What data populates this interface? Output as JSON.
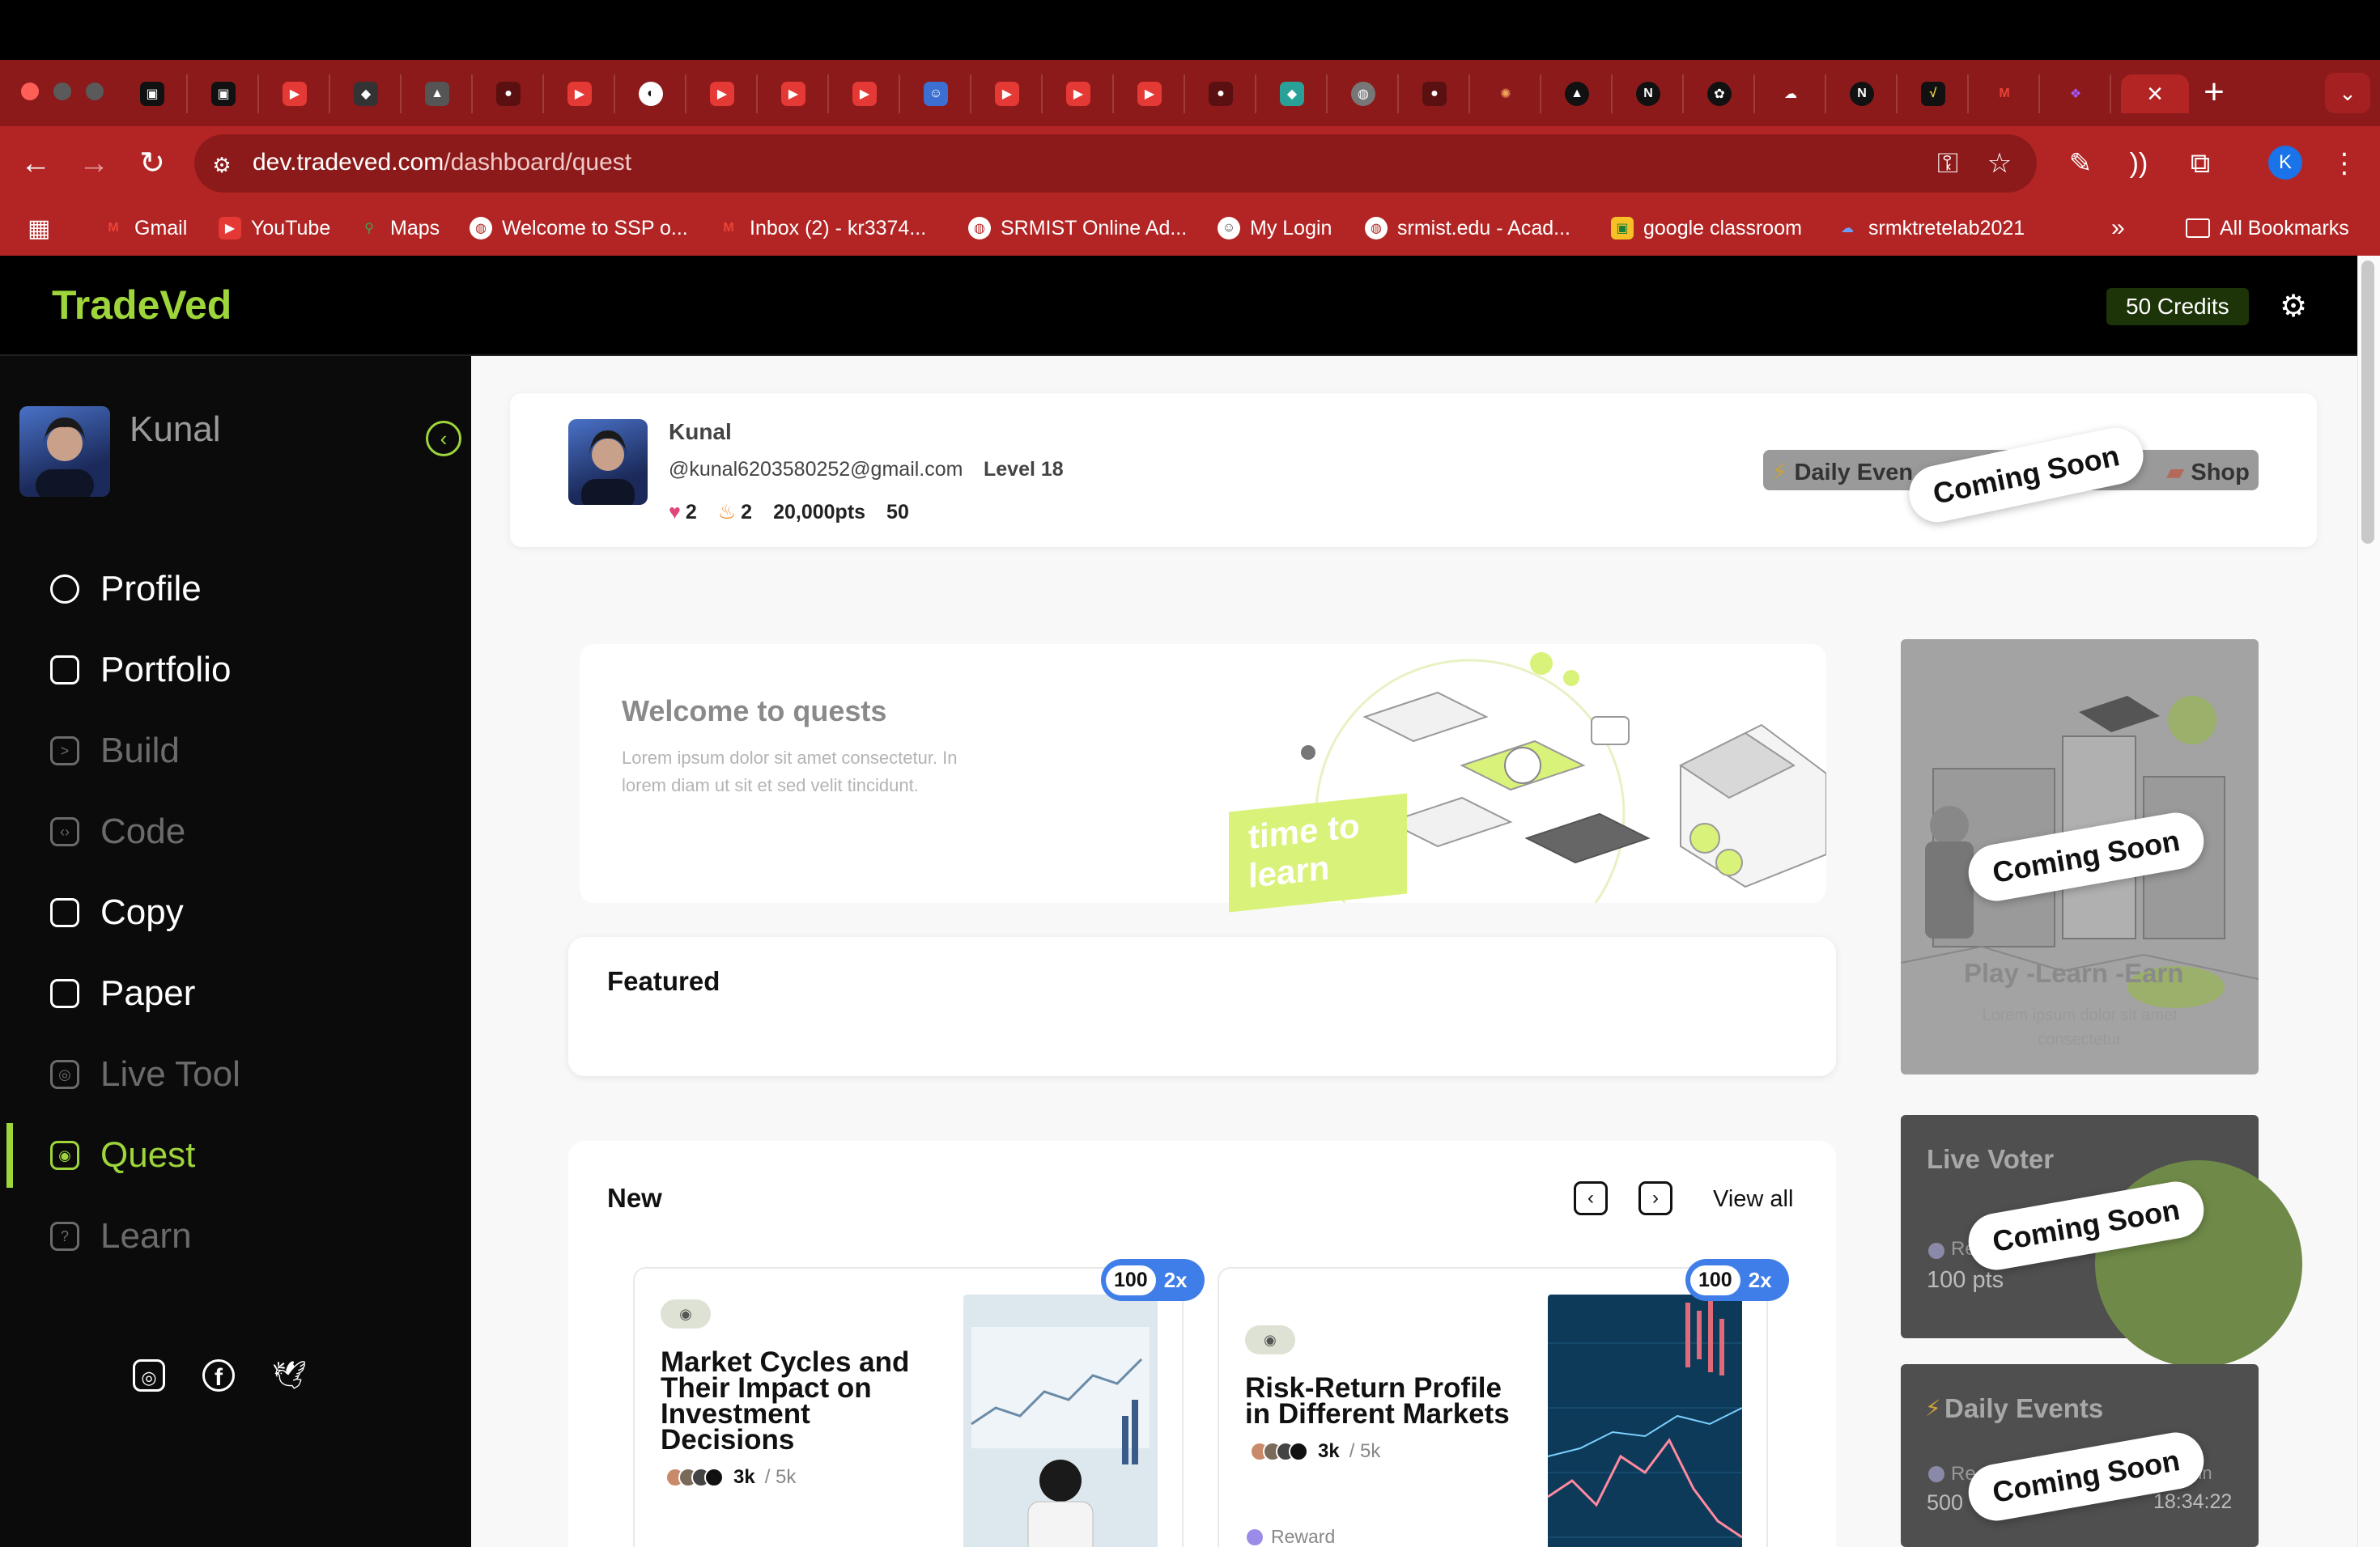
{
  "browser": {
    "url_host": "dev.tradeved.com",
    "url_path": "/dashboard/quest",
    "bookmarks": [
      "Gmail",
      "YouTube",
      "Maps",
      "Welcome to SSP o...",
      "Inbox (2) - kr3374...",
      "SRMIST Online Ad...",
      "My Login",
      "srmist.edu - Acad...",
      "google classroom",
      "srmktretelab2021"
    ],
    "all_bookmarks": "All Bookmarks",
    "more_bookmarks": "»",
    "profile_initial": "K"
  },
  "app": {
    "brand": "TradeVed",
    "credits": "50 Credits"
  },
  "sidebar": {
    "user": "Kunal",
    "items": [
      {
        "label": "Profile"
      },
      {
        "label": "Portfolio"
      },
      {
        "label": "Build"
      },
      {
        "label": "Code"
      },
      {
        "label": "Copy"
      },
      {
        "label": "Paper"
      },
      {
        "label": "Live Tool"
      },
      {
        "label": "Quest"
      },
      {
        "label": "Learn"
      }
    ]
  },
  "profile": {
    "name": "Kunal",
    "email": "@kunal6203580252@gmail.com",
    "level": "Level 18",
    "likes": "2",
    "streak": "2",
    "points": "20,000pts",
    "score": "50",
    "chip_daily": "Daily Even",
    "chip_shop": "Shop",
    "coming_soon": "Coming Soon"
  },
  "welcome": {
    "title": "Welcome to quests",
    "text": "Lorem ipsum dolor sit amet consectetur. In lorem diam ut sit et sed velit tincidunt.",
    "art_text": "time to learn"
  },
  "featured": {
    "title": "Featured"
  },
  "new_section": {
    "title": "New",
    "view_all": "View all",
    "cards": [
      {
        "title": "Market Cycles and Their Impact on Investment Decisions",
        "count": "3k",
        "total": "/ 5k",
        "xp": "100",
        "mult": "2x"
      },
      {
        "title": "Risk-Return Profile in Different Markets",
        "count": "3k",
        "total": "/ 5k",
        "xp": "100",
        "mult": "2x",
        "reward": "Reward"
      }
    ]
  },
  "right": {
    "play_title": "Play -Learn -Earn",
    "play_sub": "Lorem ipsum dolor sit amet consectetur",
    "voter_title": "Live Voter",
    "voter_pts": "100 pts",
    "voter_re": "Re",
    "daily_title": "Daily Events",
    "daily_re": "Re",
    "daily_left": "500",
    "daily_ends": "nts in",
    "daily_time": "18:34:22",
    "coming_soon": "Coming Soon"
  },
  "colors": {
    "accent": "#9ed53a",
    "browser_red": "#b32525",
    "badge_blue": "#3f7ee8"
  }
}
